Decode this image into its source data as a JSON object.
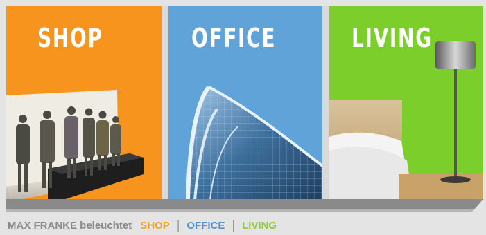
{
  "panels": {
    "shop": {
      "title": "SHOP"
    },
    "office": {
      "title": "OFFICE"
    },
    "living": {
      "title": "LIVING"
    }
  },
  "footer": {
    "brand": "MAX FRANKE beleuchtet",
    "links": [
      {
        "label": "SHOP",
        "color": "#f7a21a"
      },
      {
        "label": "OFFICE",
        "color": "#4f8fd3"
      },
      {
        "label": "LIVING",
        "color": "#8ccc3a"
      }
    ],
    "separator": "|"
  },
  "colors": {
    "shop": "#f7941e",
    "office": "#5fa3d8",
    "living": "#7ccf2a",
    "background": "#e4e4e4"
  }
}
